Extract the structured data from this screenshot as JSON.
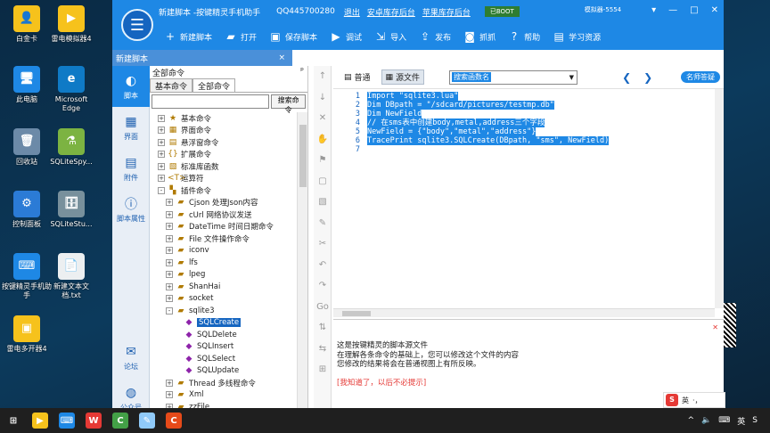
{
  "desktop": {
    "icons": [
      {
        "label": "白金卡",
        "color": "#f6c21c",
        "glyph": "👤"
      },
      {
        "label": "雷电模拟器4",
        "color": "#f6c21c",
        "glyph": "▶"
      },
      {
        "label": "此电脑",
        "color": "#1e88e5",
        "glyph": "🖥"
      },
      {
        "label": "Microsoft Edge",
        "color": "#0f7ac6",
        "glyph": "e"
      },
      {
        "label": "回收站",
        "color": "#6c8aa8",
        "glyph": "🗑"
      },
      {
        "label": "SQLiteSpy...",
        "color": "#7cb342",
        "glyph": "⚗"
      },
      {
        "label": "控制面板",
        "color": "#2b7bd6",
        "glyph": "⚙"
      },
      {
        "label": "SQLiteStu...",
        "color": "#78909c",
        "glyph": "🗄"
      },
      {
        "label": "按键精灵手机助手",
        "color": "#1e88e5",
        "glyph": "⌨"
      },
      {
        "label": "新建文本文档.txt",
        "color": "#eceff1",
        "glyph": "📄"
      },
      {
        "label": "雷电多开器4",
        "color": "#f6c21c",
        "glyph": "▣"
      }
    ]
  },
  "titlebar": {
    "title": "新建脚本 -按键精灵手机助手",
    "qq": "QQ445700280",
    "links": [
      "退出",
      "安卓库存后台",
      "苹果库存后台"
    ],
    "badge": "已BOOT",
    "status": "模拟器-5554",
    "controls": {
      "min": "▾",
      "restore": "—",
      "max": "□",
      "close": "✕"
    }
  },
  "toolbar": {
    "buttons": [
      {
        "icon": "plus-icon",
        "glyph": "+",
        "label": "新建脚本"
      },
      {
        "icon": "folder-icon",
        "glyph": "▰",
        "label": "打开"
      },
      {
        "icon": "save-icon",
        "glyph": "▣",
        "label": "保存脚本"
      },
      {
        "icon": "play-icon",
        "glyph": "▶",
        "label": "调试"
      },
      {
        "icon": "import-icon",
        "glyph": "⇲",
        "label": "导入"
      },
      {
        "icon": "publish-icon",
        "glyph": "⇪",
        "label": "发布"
      },
      {
        "icon": "camera-icon",
        "glyph": "◙",
        "label": "抓抓"
      },
      {
        "icon": "help-icon",
        "glyph": "?",
        "label": "帮助"
      },
      {
        "icon": "book-icon",
        "glyph": "▤",
        "label": "学习资源"
      }
    ]
  },
  "doc_tab": {
    "label": "新建脚本",
    "close": "×"
  },
  "leftnav": [
    {
      "icon": "script-icon",
      "glyph": "◐",
      "label": "脚本"
    },
    {
      "icon": "interface-icon",
      "glyph": "▦",
      "label": "界面"
    },
    {
      "icon": "attachment-icon",
      "glyph": "▤",
      "label": "附件"
    },
    {
      "icon": "properties-icon",
      "glyph": "ⓘ",
      "label": "脚本属性"
    },
    {
      "icon": "forum-icon",
      "glyph": "✉",
      "label": "论坛"
    },
    {
      "icon": "wechat-icon",
      "glyph": "◍",
      "label": "公众号"
    }
  ],
  "commands": {
    "header": "全部命令",
    "pin": "ᵖ",
    "tabs": [
      "基本命令",
      "全部命令"
    ],
    "search_value": "",
    "search_button": "搜索命令",
    "tree": [
      {
        "indent": 1,
        "exp": "+",
        "icon": "★",
        "label": "基本命令"
      },
      {
        "indent": 1,
        "exp": "+",
        "icon": "▦",
        "label": "界面命令"
      },
      {
        "indent": 1,
        "exp": "+",
        "icon": "▤",
        "label": "悬浮窗命令"
      },
      {
        "indent": 1,
        "exp": "+",
        "icon": "{}",
        "label": "扩展命令"
      },
      {
        "indent": 1,
        "exp": "+",
        "icon": "▧",
        "label": "标准库函数"
      },
      {
        "indent": 1,
        "exp": "+",
        "icon": "<T>",
        "label": "运算符"
      },
      {
        "indent": 1,
        "exp": "-",
        "icon": "▚",
        "label": "插件命令"
      },
      {
        "indent": 2,
        "exp": "+",
        "icon": "▰",
        "label": "Cjson 处理Json内容"
      },
      {
        "indent": 2,
        "exp": "+",
        "icon": "▰",
        "label": "cUrl 网络协议发送"
      },
      {
        "indent": 2,
        "exp": "+",
        "icon": "▰",
        "label": "DateTime 时间日期命令"
      },
      {
        "indent": 2,
        "exp": "+",
        "icon": "▰",
        "label": "File 文件操作命令"
      },
      {
        "indent": 2,
        "exp": "+",
        "icon": "▰",
        "label": "iconv"
      },
      {
        "indent": 2,
        "exp": "+",
        "icon": "▰",
        "label": "lfs"
      },
      {
        "indent": 2,
        "exp": "+",
        "icon": "▰",
        "label": "lpeg"
      },
      {
        "indent": 2,
        "exp": "+",
        "icon": "▰",
        "label": "ShanHai"
      },
      {
        "indent": 2,
        "exp": "+",
        "icon": "▰",
        "label": "socket"
      },
      {
        "indent": 2,
        "exp": "-",
        "icon": "▰",
        "label": "sqlite3"
      },
      {
        "indent": 3,
        "exp": "",
        "icon": "◆",
        "label": "SQLCreate",
        "selected": true
      },
      {
        "indent": 3,
        "exp": "",
        "icon": "◆",
        "label": "SQLDelete"
      },
      {
        "indent": 3,
        "exp": "",
        "icon": "◆",
        "label": "SQLInsert"
      },
      {
        "indent": 3,
        "exp": "",
        "icon": "◆",
        "label": "SQLSelect"
      },
      {
        "indent": 3,
        "exp": "",
        "icon": "◆",
        "label": "SQLUpdate"
      },
      {
        "indent": 2,
        "exp": "+",
        "icon": "▰",
        "label": "Thread 多线程命令"
      },
      {
        "indent": 2,
        "exp": "+",
        "icon": "▰",
        "label": "Xml"
      },
      {
        "indent": 2,
        "exp": "+",
        "icon": "▰",
        "label": "zzFile"
      }
    ]
  },
  "sideicons": [
    "↑",
    "↓",
    "✕",
    "✋",
    "⚑",
    "▢",
    "▧",
    "✎",
    "✂",
    "↶",
    "↷",
    "Go",
    "⇅",
    "⇆",
    "⊞"
  ],
  "editor": {
    "tabs": [
      {
        "label": "普通",
        "glyph": "▤"
      },
      {
        "label": "源文件",
        "glyph": "▦"
      }
    ],
    "select_value": "搜索函数名",
    "arrow_left": "❮",
    "arrow_right": "❯",
    "help_button": "名师答疑",
    "line_numbers": [
      "1",
      "2",
      "3",
      "4",
      "5",
      "6",
      "7"
    ],
    "lines": [
      "Import \"sqlite3.lua\"",
      "Dim DBpath = \"/sdcard/pictures/testmp.db\"",
      "Dim NewField",
      "// 在sms表中创建body,metal,address三个字段",
      "NewField = {\"body\",\"metal\",\"address\"}",
      "TracePrint sqlite3.SQLCreate(DBpath, \"sms\", NewField)"
    ]
  },
  "info": {
    "close": "✕",
    "lines": [
      "这是按键精灵的脚本源文件",
      "在理解各条命令的基础上，您可以修改这个文件的内容",
      "您修改的结果将会在普通视图上有所反映。"
    ],
    "link": "[我知道了，以后不必提示]"
  },
  "ime": {
    "brand": "S",
    "lang": "英",
    "extra": "·，"
  },
  "taskbar": {
    "apps": [
      {
        "name": "start-icon",
        "glyph": "⊞",
        "color": "transparent"
      },
      {
        "name": "ldplayer-icon",
        "glyph": "▶",
        "color": "#f6c21c"
      },
      {
        "name": "anjian-icon",
        "glyph": "⌨",
        "color": "#1e88e5"
      },
      {
        "name": "wps-icon",
        "glyph": "W",
        "color": "#e53935"
      },
      {
        "name": "camtasia-icon",
        "glyph": "C",
        "color": "#43a047"
      },
      {
        "name": "notepad-icon",
        "glyph": "✎",
        "color": "#90caf9"
      },
      {
        "name": "recorder-icon",
        "glyph": "C",
        "color": "#e64a19"
      }
    ],
    "tray": [
      "^",
      "🔈",
      "⌨",
      "英",
      "S"
    ]
  }
}
